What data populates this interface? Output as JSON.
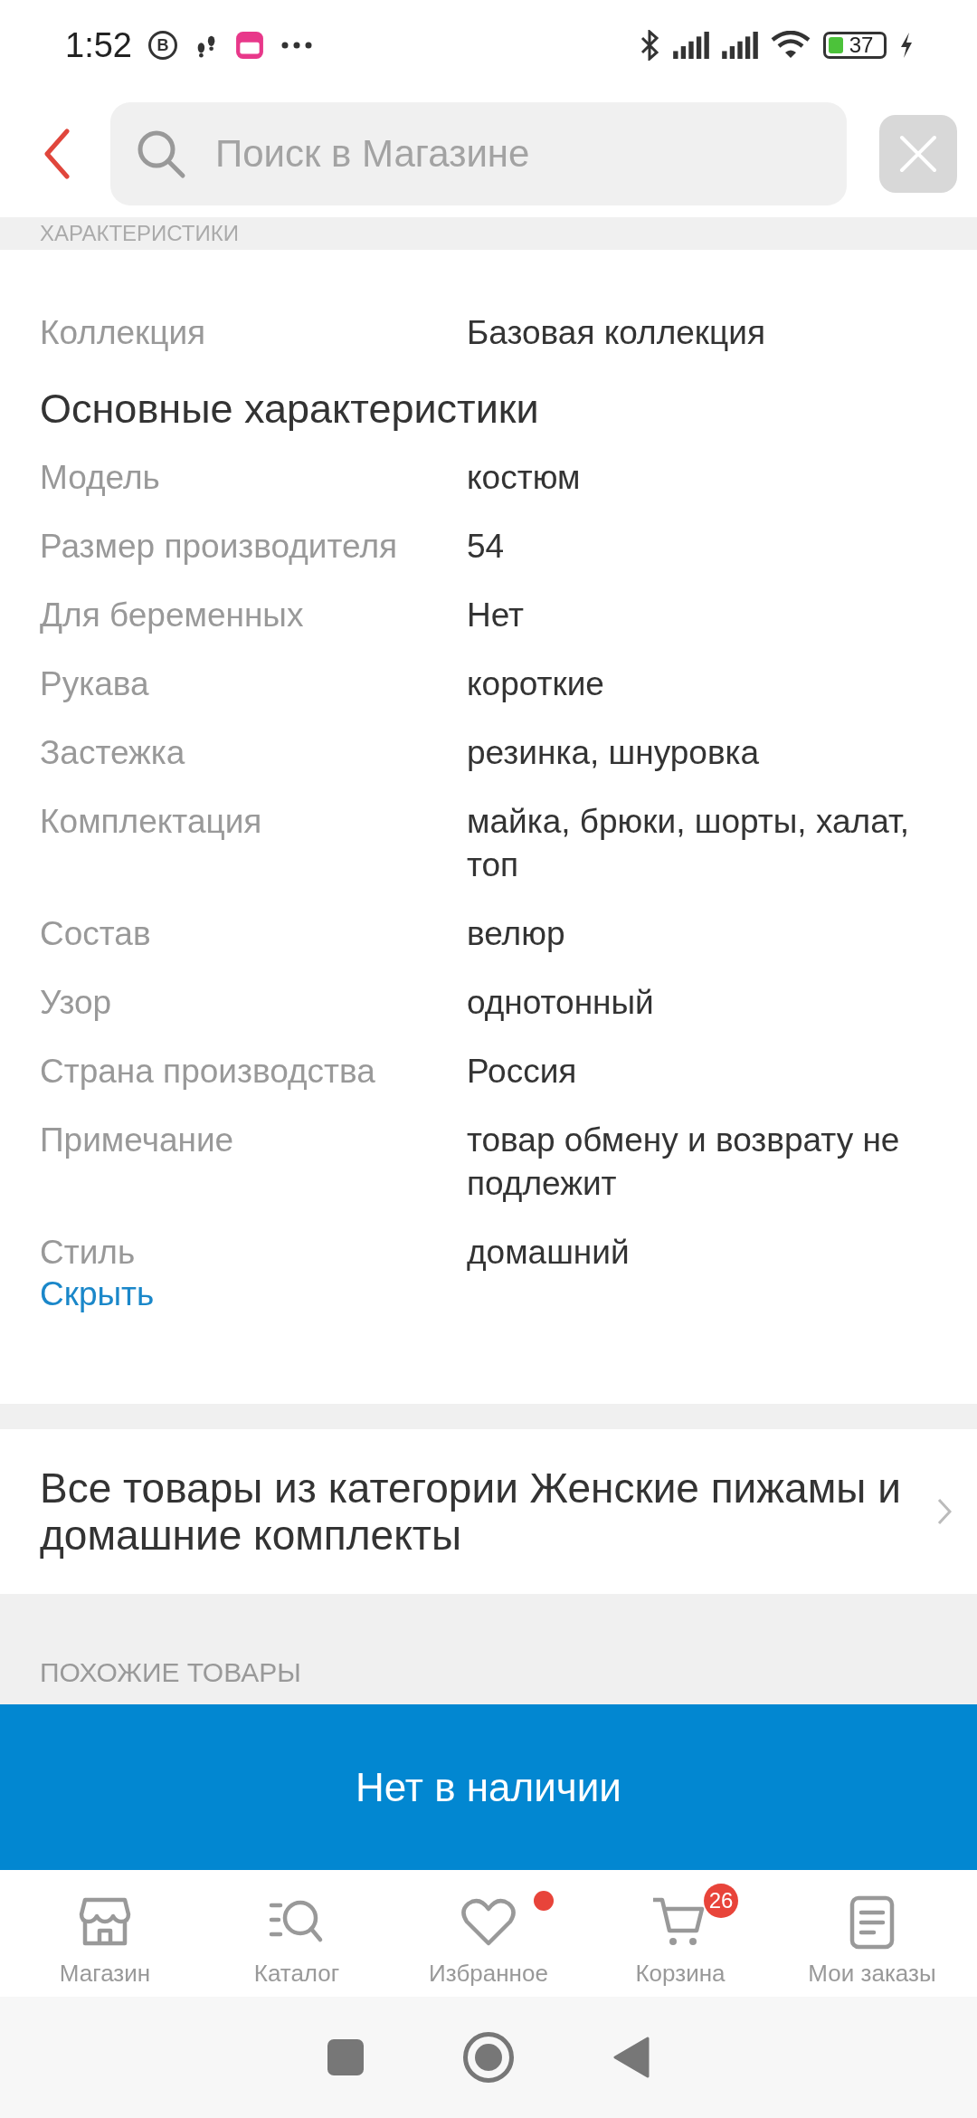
{
  "status_bar": {
    "time": "1:52",
    "chat_icon_letter": "B",
    "battery": "37"
  },
  "header": {
    "search": {
      "placeholder": "Поиск в Магазине"
    }
  },
  "section_title": "ХАРАКТЕРИСТИКИ",
  "spec_groups": [
    {
      "rows": [
        {
          "label": "Коллекция",
          "value": "Базовая коллекция"
        }
      ]
    },
    {
      "title": "Основные характеристики",
      "rows": [
        {
          "label": "Модель",
          "value": "костюм"
        },
        {
          "label": "Размер производителя",
          "value": "54"
        },
        {
          "label": "Для беременных",
          "value": "Нет"
        },
        {
          "label": "Рукава",
          "value": "короткие"
        },
        {
          "label": "Застежка",
          "value": "резинка, шнуровка"
        },
        {
          "label": "Комплектация",
          "value": "майка, брюки, шорты, халат, топ"
        },
        {
          "label": "Состав",
          "value": "велюр"
        },
        {
          "label": "Узор",
          "value": "однотонный"
        },
        {
          "label": "Страна производства",
          "value": "Россия"
        },
        {
          "label": "Примечание",
          "value": "товар обмену и возврату не подлежит"
        },
        {
          "label": "Стиль",
          "value": "домашний"
        }
      ]
    }
  ],
  "hide_link": "Скрыть",
  "category_link": "Все товары из категории Женские пижамы и домашние комплекты",
  "similar_title": "ПОХОЖИЕ ТОВАРЫ",
  "action_button": "Нет в наличии",
  "bottom_nav": [
    {
      "kind": "store",
      "label": "Магазин"
    },
    {
      "kind": "catalog",
      "label": "Каталог"
    },
    {
      "kind": "favorites",
      "label": "Избранное",
      "dot": true
    },
    {
      "kind": "cart",
      "label": "Корзина",
      "badge": "26"
    },
    {
      "kind": "orders",
      "label": "Мои заказы"
    }
  ]
}
